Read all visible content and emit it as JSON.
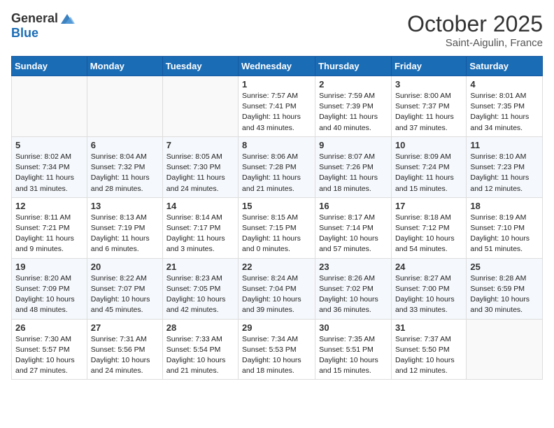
{
  "header": {
    "logo_general": "General",
    "logo_blue": "Blue",
    "title": "October 2025",
    "location": "Saint-Aigulin, France"
  },
  "days_of_week": [
    "Sunday",
    "Monday",
    "Tuesday",
    "Wednesday",
    "Thursday",
    "Friday",
    "Saturday"
  ],
  "weeks": [
    [
      {
        "day": "",
        "info": ""
      },
      {
        "day": "",
        "info": ""
      },
      {
        "day": "",
        "info": ""
      },
      {
        "day": "1",
        "info": "Sunrise: 7:57 AM\nSunset: 7:41 PM\nDaylight: 11 hours\nand 43 minutes."
      },
      {
        "day": "2",
        "info": "Sunrise: 7:59 AM\nSunset: 7:39 PM\nDaylight: 11 hours\nand 40 minutes."
      },
      {
        "day": "3",
        "info": "Sunrise: 8:00 AM\nSunset: 7:37 PM\nDaylight: 11 hours\nand 37 minutes."
      },
      {
        "day": "4",
        "info": "Sunrise: 8:01 AM\nSunset: 7:35 PM\nDaylight: 11 hours\nand 34 minutes."
      }
    ],
    [
      {
        "day": "5",
        "info": "Sunrise: 8:02 AM\nSunset: 7:34 PM\nDaylight: 11 hours\nand 31 minutes."
      },
      {
        "day": "6",
        "info": "Sunrise: 8:04 AM\nSunset: 7:32 PM\nDaylight: 11 hours\nand 28 minutes."
      },
      {
        "day": "7",
        "info": "Sunrise: 8:05 AM\nSunset: 7:30 PM\nDaylight: 11 hours\nand 24 minutes."
      },
      {
        "day": "8",
        "info": "Sunrise: 8:06 AM\nSunset: 7:28 PM\nDaylight: 11 hours\nand 21 minutes."
      },
      {
        "day": "9",
        "info": "Sunrise: 8:07 AM\nSunset: 7:26 PM\nDaylight: 11 hours\nand 18 minutes."
      },
      {
        "day": "10",
        "info": "Sunrise: 8:09 AM\nSunset: 7:24 PM\nDaylight: 11 hours\nand 15 minutes."
      },
      {
        "day": "11",
        "info": "Sunrise: 8:10 AM\nSunset: 7:23 PM\nDaylight: 11 hours\nand 12 minutes."
      }
    ],
    [
      {
        "day": "12",
        "info": "Sunrise: 8:11 AM\nSunset: 7:21 PM\nDaylight: 11 hours\nand 9 minutes."
      },
      {
        "day": "13",
        "info": "Sunrise: 8:13 AM\nSunset: 7:19 PM\nDaylight: 11 hours\nand 6 minutes."
      },
      {
        "day": "14",
        "info": "Sunrise: 8:14 AM\nSunset: 7:17 PM\nDaylight: 11 hours\nand 3 minutes."
      },
      {
        "day": "15",
        "info": "Sunrise: 8:15 AM\nSunset: 7:15 PM\nDaylight: 11 hours\nand 0 minutes."
      },
      {
        "day": "16",
        "info": "Sunrise: 8:17 AM\nSunset: 7:14 PM\nDaylight: 10 hours\nand 57 minutes."
      },
      {
        "day": "17",
        "info": "Sunrise: 8:18 AM\nSunset: 7:12 PM\nDaylight: 10 hours\nand 54 minutes."
      },
      {
        "day": "18",
        "info": "Sunrise: 8:19 AM\nSunset: 7:10 PM\nDaylight: 10 hours\nand 51 minutes."
      }
    ],
    [
      {
        "day": "19",
        "info": "Sunrise: 8:20 AM\nSunset: 7:09 PM\nDaylight: 10 hours\nand 48 minutes."
      },
      {
        "day": "20",
        "info": "Sunrise: 8:22 AM\nSunset: 7:07 PM\nDaylight: 10 hours\nand 45 minutes."
      },
      {
        "day": "21",
        "info": "Sunrise: 8:23 AM\nSunset: 7:05 PM\nDaylight: 10 hours\nand 42 minutes."
      },
      {
        "day": "22",
        "info": "Sunrise: 8:24 AM\nSunset: 7:04 PM\nDaylight: 10 hours\nand 39 minutes."
      },
      {
        "day": "23",
        "info": "Sunrise: 8:26 AM\nSunset: 7:02 PM\nDaylight: 10 hours\nand 36 minutes."
      },
      {
        "day": "24",
        "info": "Sunrise: 8:27 AM\nSunset: 7:00 PM\nDaylight: 10 hours\nand 33 minutes."
      },
      {
        "day": "25",
        "info": "Sunrise: 8:28 AM\nSunset: 6:59 PM\nDaylight: 10 hours\nand 30 minutes."
      }
    ],
    [
      {
        "day": "26",
        "info": "Sunrise: 7:30 AM\nSunset: 5:57 PM\nDaylight: 10 hours\nand 27 minutes."
      },
      {
        "day": "27",
        "info": "Sunrise: 7:31 AM\nSunset: 5:56 PM\nDaylight: 10 hours\nand 24 minutes."
      },
      {
        "day": "28",
        "info": "Sunrise: 7:33 AM\nSunset: 5:54 PM\nDaylight: 10 hours\nand 21 minutes."
      },
      {
        "day": "29",
        "info": "Sunrise: 7:34 AM\nSunset: 5:53 PM\nDaylight: 10 hours\nand 18 minutes."
      },
      {
        "day": "30",
        "info": "Sunrise: 7:35 AM\nSunset: 5:51 PM\nDaylight: 10 hours\nand 15 minutes."
      },
      {
        "day": "31",
        "info": "Sunrise: 7:37 AM\nSunset: 5:50 PM\nDaylight: 10 hours\nand 12 minutes."
      },
      {
        "day": "",
        "info": ""
      }
    ]
  ]
}
